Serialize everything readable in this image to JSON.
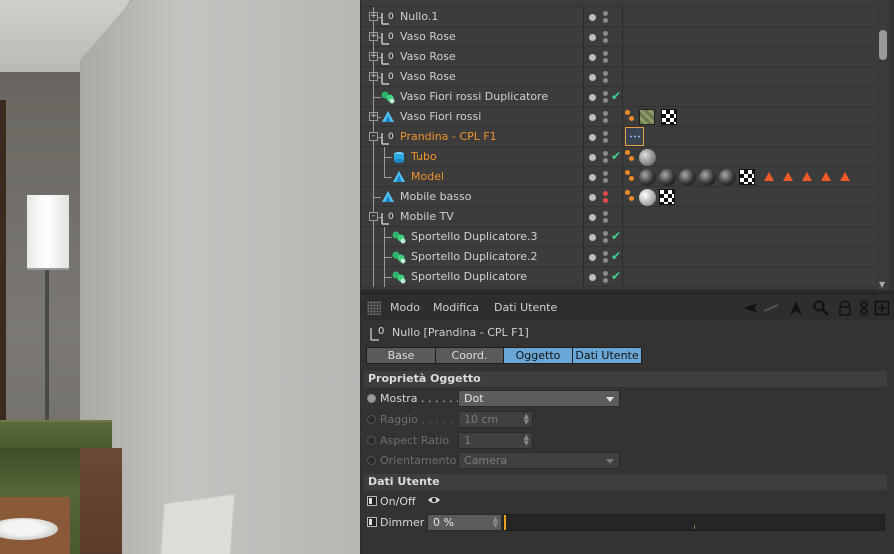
{
  "object_manager": {
    "rows": [
      {
        "name": "Nullo.1",
        "indent": 0,
        "icon": "null-icon",
        "expander": "+",
        "tree": "mid",
        "dots": "normal",
        "check": false,
        "tags": []
      },
      {
        "name": "Vaso Rose",
        "indent": 0,
        "icon": "null-icon",
        "expander": "+",
        "tree": "mid",
        "dots": "normal",
        "check": false,
        "tags": []
      },
      {
        "name": "Vaso Rose",
        "indent": 0,
        "icon": "null-icon",
        "expander": "+",
        "tree": "mid",
        "dots": "normal",
        "check": false,
        "tags": []
      },
      {
        "name": "Vaso Rose",
        "indent": 0,
        "icon": "null-icon",
        "expander": "+",
        "tree": "mid",
        "dots": "normal",
        "check": false,
        "tags": []
      },
      {
        "name": "Vaso Fiori rossi Duplicatore",
        "indent": 0,
        "icon": "cloner-icon",
        "expander": "",
        "tree": "mid",
        "dots": "normal",
        "check": true,
        "tags": []
      },
      {
        "name": "Vaso Fiori rossi",
        "indent": 0,
        "icon": "polygon-icon",
        "expander": "+",
        "tree": "mid",
        "dots": "normal",
        "check": false,
        "tags": [
          "phong",
          "tex-green",
          "checker"
        ]
      },
      {
        "name": "Prandina - CPL F1",
        "indent": 0,
        "icon": "null-icon",
        "expander": "-",
        "tree": "mid",
        "dots": "normal",
        "check": false,
        "active": true,
        "tags": [
          "selection"
        ]
      },
      {
        "name": "Tubo",
        "indent": 1,
        "icon": "tube-icon",
        "expander": "",
        "tree": "mid",
        "dots": "normal",
        "check": true,
        "active": true,
        "tags": [
          "phong",
          "sphere-grey"
        ]
      },
      {
        "name": "Model",
        "indent": 1,
        "icon": "polygon-icon",
        "expander": "",
        "tree": "end",
        "dots": "normal",
        "check": false,
        "active": true,
        "tags": [
          "phong",
          "sphere-dark",
          "sphere-dark",
          "sphere-dark",
          "sphere-dark",
          "sphere-dark",
          "checker",
          "tri",
          "tri",
          "tri",
          "tri",
          "tri"
        ]
      },
      {
        "name": "Mobile basso",
        "indent": 0,
        "icon": "polygon-icon",
        "expander": "",
        "tree": "mid",
        "dots": "red",
        "check": false,
        "tags": [
          "phong",
          "sphere-white",
          "checker"
        ]
      },
      {
        "name": "Mobile TV",
        "indent": 0,
        "icon": "null-icon",
        "expander": "-",
        "tree": "mid",
        "dots": "normal",
        "check": false,
        "tags": []
      },
      {
        "name": "Sportello Duplicatore.3",
        "indent": 1,
        "icon": "cloner-icon",
        "expander": "",
        "tree": "mid",
        "dots": "normal",
        "check": true,
        "tags": []
      },
      {
        "name": "Sportello Duplicatore.2",
        "indent": 1,
        "icon": "cloner-icon",
        "expander": "",
        "tree": "mid",
        "dots": "normal",
        "check": true,
        "tags": []
      },
      {
        "name": "Sportello Duplicatore",
        "indent": 1,
        "icon": "cloner-icon",
        "expander": "",
        "tree": "mid",
        "dots": "normal",
        "check": true,
        "tags": []
      }
    ]
  },
  "attribute_manager": {
    "menu": [
      "Modo",
      "Modifica",
      "Dati Utente"
    ],
    "toolbar_icons": [
      "back-arrow-icon",
      "forward-arrow-icon",
      "cursor-icon",
      "search-icon",
      "lock-icon",
      "link-icon",
      "new-panel-icon"
    ],
    "title": "Nullo [Prandina - CPL F1]",
    "tabs": [
      {
        "label": "Base",
        "active": false
      },
      {
        "label": "Coord.",
        "active": false
      },
      {
        "label": "Oggetto",
        "active": true
      },
      {
        "label": "Dati Utente",
        "active": true
      }
    ],
    "object_section": {
      "header": "Proprietà Oggetto",
      "mostra": {
        "label": "Mostra . . . . . .",
        "value": "Dot"
      },
      "raggio": {
        "label": "Raggio . . . . . .",
        "value": "10 cm"
      },
      "aspect_ratio": {
        "label": "Aspect Ratio",
        "value": "1"
      },
      "orientamento": {
        "label": "Orientamento",
        "value": "Camera"
      }
    },
    "user_section": {
      "header": "Dati Utente",
      "onoff_label": "On/Off",
      "dimmer_label": "Dimmer",
      "dimmer_value": "0 %",
      "dimmer_fraction": 0
    }
  },
  "colors": {
    "active_object": "#f0932b",
    "tab_active": "#6aa7d6",
    "check": "#3dd68c",
    "warning_triangle": "#ef5a28"
  }
}
